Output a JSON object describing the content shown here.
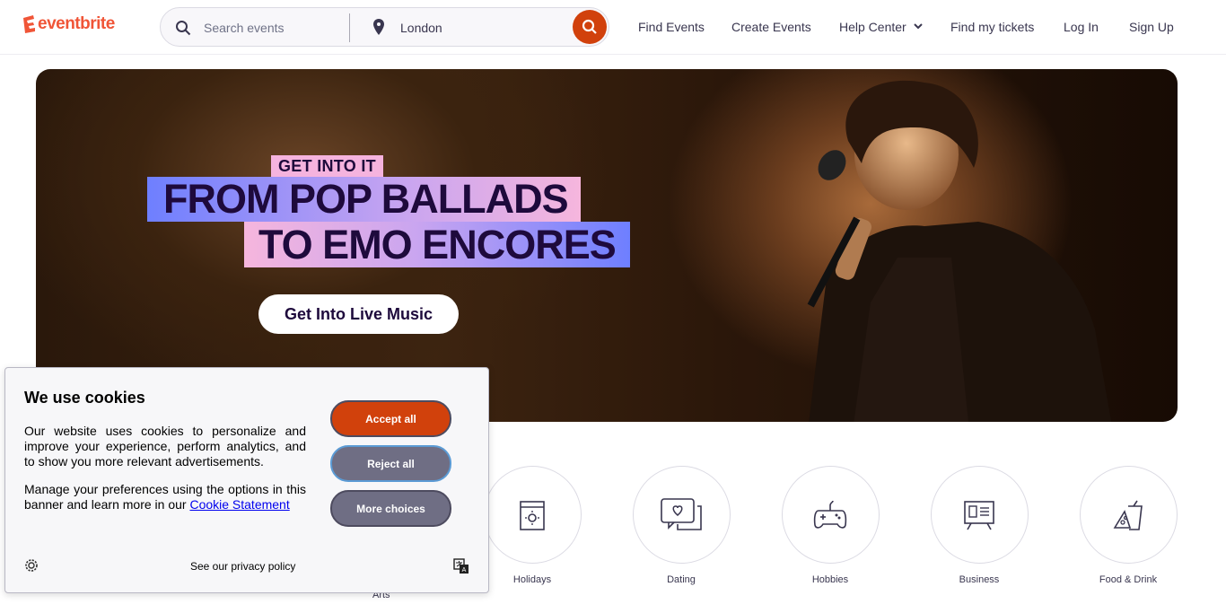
{
  "header": {
    "logo": "eventbrite",
    "search_placeholder": "Search events",
    "location": "London",
    "nav": [
      "Find Events",
      "Create Events",
      "Help Center",
      "Find my tickets",
      "Log In",
      "Sign Up"
    ]
  },
  "hero": {
    "tag": "GET INTO IT",
    "line1": "FROM POP BALLADS",
    "line2": "TO EMO ENCORES",
    "cta": "Get Into Live Music"
  },
  "categories": [
    "Arts",
    "Holidays",
    "Dating",
    "Hobbies",
    "Business",
    "Food & Drink"
  ],
  "cookie": {
    "title": "We use cookies",
    "p1": "Our website uses cookies to personalize and improve your experience, perform analytics, and to show you more relevant advertisements.",
    "p2_prefix": "Manage your preferences using the options in this banner and learn more in our ",
    "p2_link": "Cookie Statement",
    "accept": "Accept all",
    "reject": "Reject all",
    "more": "More choices",
    "privacy": "See our privacy policy"
  },
  "colors": {
    "brand": "#f05537",
    "accent": "#d1410c"
  }
}
